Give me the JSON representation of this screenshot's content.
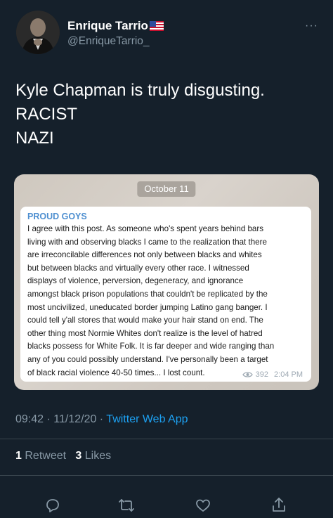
{
  "tweet": {
    "display_name": "Enrique Tarrio",
    "handle": "@EnriqueTarrio_",
    "flag_icon": "us-flag-icon",
    "more_label": "···",
    "text": "Kyle Chapman is truly disgusting.\nRACIST\nNAZI"
  },
  "embedded_image": {
    "date_label": "October 11",
    "sender": "PROUD GOYS",
    "body": "I agree with this post. As someone who's spent years behind bars\nliving with and observing blacks I came to the realization that there\nare irreconcilable differences not only between blacks and whites\nbut between blacks and virtually every other race. I witnessed\ndisplays of violence, perversion, degeneracy, and ignorance\namongst black prison populations that couldn't be replicated by the\nmost uncivilized, uneducated border jumping Latino gang banger. I\ncould tell y'all stores that would make your hair stand on end. The\nother thing most Normie Whites don't realize is the level of hatred\nblacks possess for White Folk. It is far deeper and wide ranging than\nany of you could possibly understand. I've personally been a target\nof black racial violence 40-50 times... I lost count.",
    "views": "392",
    "time": "2:04 PM"
  },
  "meta": {
    "time": "09:42",
    "date": "11/12/20",
    "separator": " · ",
    "source": "Twitter Web App"
  },
  "stats": {
    "retweets_count": "1",
    "retweets_label": "Retweet",
    "likes_count": "3",
    "likes_label": "Likes"
  },
  "colors": {
    "background": "#15202b",
    "accent": "#1da1f2",
    "secondary_text": "#8899a6"
  },
  "actions": [
    "reply-icon",
    "retweet-icon",
    "like-icon",
    "share-icon"
  ]
}
